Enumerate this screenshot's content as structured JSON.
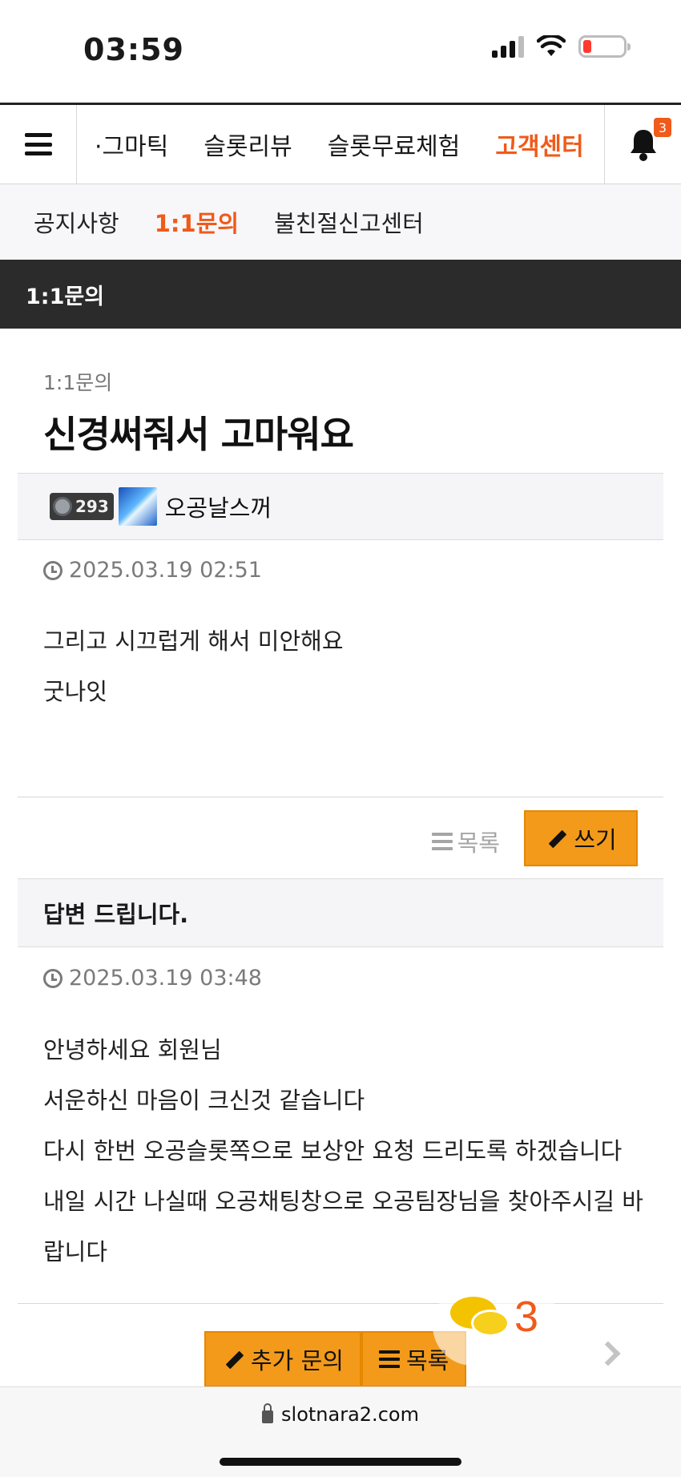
{
  "status_bar": {
    "time": "03:59"
  },
  "nav": {
    "items": [
      "·그마틱",
      "슬롯리뷰",
      "슬롯무료체험",
      "고객센터"
    ],
    "active_index": 3,
    "notification_count": "3"
  },
  "subnav": {
    "items": [
      "공지사항",
      "1:1문의",
      "불친절신고센터"
    ],
    "active_index": 1
  },
  "section": {
    "title": "1:1문의"
  },
  "post": {
    "category": "1:1문의",
    "title": "신경써줘서 고마워요",
    "author_level": "293",
    "author_name": "오공날스꺼",
    "date": "2025.03.19 02:51",
    "lines": [
      "그리고 시끄럽게 해서 미안해요",
      "굿나잇"
    ]
  },
  "actions": {
    "list_label": "목록",
    "write_label": "쓰기"
  },
  "answer": {
    "header": "답변 드립니다.",
    "date": "2025.03.19 03:48",
    "lines": [
      "안녕하세요 회원님",
      "서운하신 마음이 크신것 같습니다",
      "다시 한번 오공슬롯쪽으로 보상안 요청 드리도록 하겠습니다",
      "내일 시간 나실때 오공채팅창으로 오공팀장님을 찾아주시길 바",
      "랍니다"
    ]
  },
  "bottom_actions": {
    "add_inquiry_label": "추가 문의",
    "list_label": "목록"
  },
  "chat": {
    "count": "3"
  },
  "browser": {
    "url": "slotnara2.com"
  },
  "colors": {
    "accent": "#f05a1a",
    "button": "#f39a1b",
    "header_dark": "#2b2b2b"
  }
}
